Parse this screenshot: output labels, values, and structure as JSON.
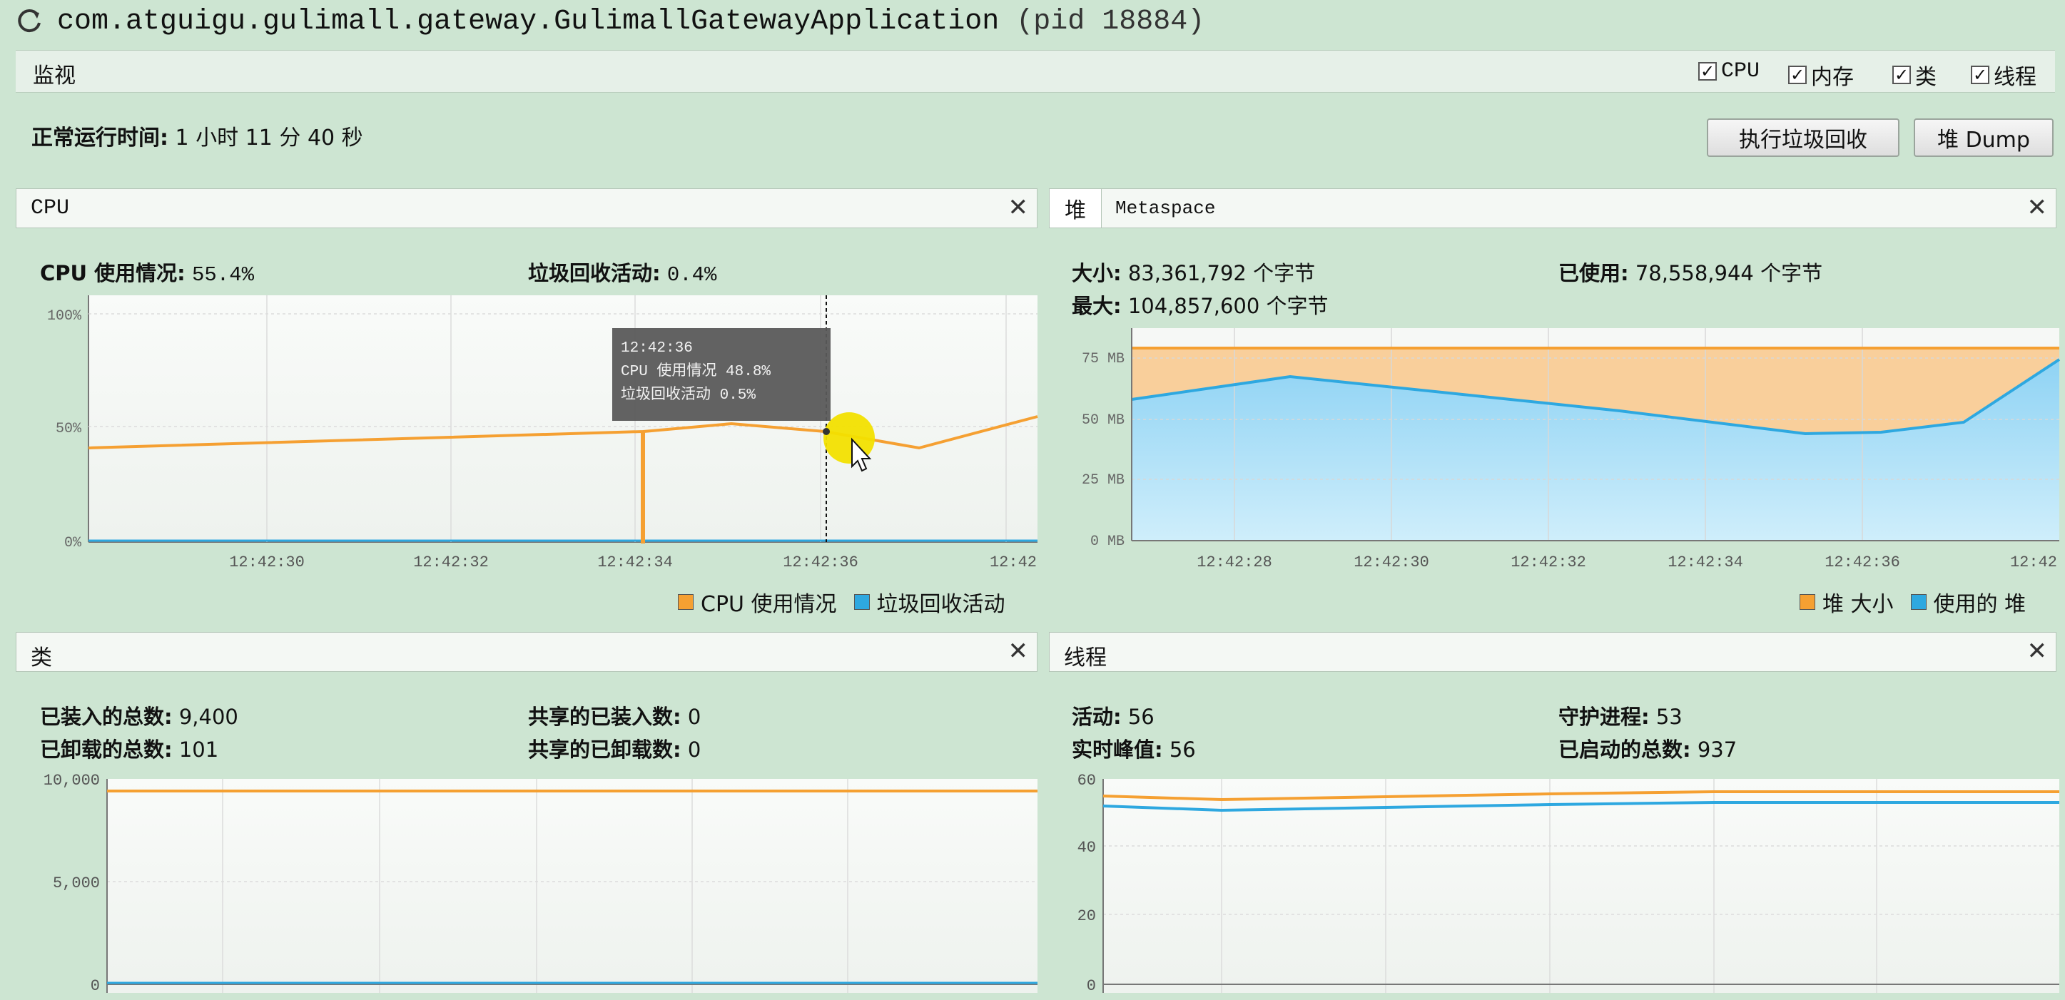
{
  "window": {
    "title": "com.atguigu.gulimall.gateway.GulimallGatewayApplication",
    "pid": "(pid 18884)"
  },
  "monitor": {
    "label": "监视",
    "checkboxes": [
      {
        "label": "CPU",
        "checked": true
      },
      {
        "label": "内存",
        "checked": true
      },
      {
        "label": "类",
        "checked": true
      },
      {
        "label": "线程",
        "checked": true
      }
    ],
    "uptime_label": "正常运行时间:",
    "uptime_value": "1 小时 11 分 40 秒",
    "gc_button": "执行垃圾回收",
    "dump_button": "堆 Dump"
  },
  "cpu_panel": {
    "title": "CPU",
    "usage_label": "CPU 使用情况:",
    "usage_value": "55.4%",
    "gc_label": "垃圾回收活动:",
    "gc_value": "0.4%",
    "tooltip": {
      "time": "12:42:36",
      "cpu": "CPU 使用情况  48.8%",
      "gc": "垃圾回收活动   0.5%"
    },
    "legend": [
      "CPU 使用情况",
      "垃圾回收活动"
    ]
  },
  "heap_panel": {
    "tab_heap": "堆",
    "tab_metaspace": "Metaspace",
    "size_label": "大小:",
    "size_value": "83,361,792 个字节",
    "used_label": "已使用:",
    "used_value": "78,558,944 个字节",
    "max_label": "最大:",
    "max_value": "104,857,600 个字节",
    "legend": [
      "堆 大小",
      "使用的 堆"
    ]
  },
  "classes_panel": {
    "title": "类",
    "loaded_label": "已装入的总数:",
    "loaded_value": "9,400",
    "unloaded_label": "已卸载的总数:",
    "unloaded_value": "101",
    "shared_loaded_label": "共享的已装入数:",
    "shared_loaded_value": "0",
    "shared_unloaded_label": "共享的已卸载数:",
    "shared_unloaded_value": "0"
  },
  "threads_panel": {
    "title": "线程",
    "live_label": "活动:",
    "live_value": "56",
    "daemon_label": "守护进程:",
    "daemon_value": "53",
    "peak_label": "实时峰值:",
    "peak_value": "56",
    "started_label": "已启动的总数:",
    "started_value": "937"
  },
  "colors": {
    "orange": "#f5a032",
    "blue": "#2ea8e0",
    "bg": "#cde5d2",
    "tooltip": "#5a5a5a"
  },
  "chart_data": [
    {
      "id": "cpu",
      "type": "line",
      "ylim": [
        0,
        100
      ],
      "yticks": [
        "0%",
        "50%",
        "100%"
      ],
      "xticks": [
        "12:42:30",
        "12:42:32",
        "12:42:34",
        "12:42:36",
        "12:42"
      ],
      "series": [
        {
          "name": "CPU 使用情况",
          "x": [
            "12:42:28",
            "12:42:34",
            "12:42:34",
            "12:42:35",
            "12:42:36",
            "12:42:37",
            "12:42:38"
          ],
          "values": [
            41,
            47,
            0,
            51,
            48.8,
            41,
            55.4
          ]
        },
        {
          "name": "垃圾回收活动",
          "x": [
            "12:42:28",
            "12:42:38"
          ],
          "values": [
            0.4,
            0.4
          ]
        }
      ]
    },
    {
      "id": "heap",
      "type": "area",
      "ylim": [
        0,
        80
      ],
      "yticks": [
        "0 MB",
        "25 MB",
        "50 MB",
        "75 MB"
      ],
      "xticks": [
        "12:42:28",
        "12:42:30",
        "12:42:32",
        "12:42:34",
        "12:42:36",
        "12:42"
      ],
      "series": [
        {
          "name": "堆 大小",
          "values": [
            79,
            79,
            79,
            79,
            79,
            79,
            79,
            79,
            79
          ]
        },
        {
          "name": "使用的 堆",
          "values": [
            58,
            67,
            61,
            55,
            48,
            44,
            45,
            49,
            75
          ]
        }
      ]
    },
    {
      "id": "classes",
      "type": "line",
      "yticks": [
        "0",
        "5,000",
        "10,000"
      ],
      "series": [
        {
          "name": "已装入的总数",
          "values": [
            9400,
            9400,
            9400,
            9400,
            9400,
            9400,
            9400
          ]
        },
        {
          "name": "共享的已装入数",
          "values": [
            0,
            0,
            0,
            0,
            0,
            0,
            0
          ]
        }
      ]
    },
    {
      "id": "threads",
      "type": "line",
      "yticks": [
        "0",
        "20",
        "40",
        "60"
      ],
      "series": [
        {
          "name": "实时峰值",
          "values": [
            54,
            53,
            54,
            55,
            56,
            56,
            56,
            56
          ]
        },
        {
          "name": "活动",
          "values": [
            51,
            50,
            51,
            52,
            52,
            52,
            52,
            52
          ]
        }
      ]
    }
  ]
}
